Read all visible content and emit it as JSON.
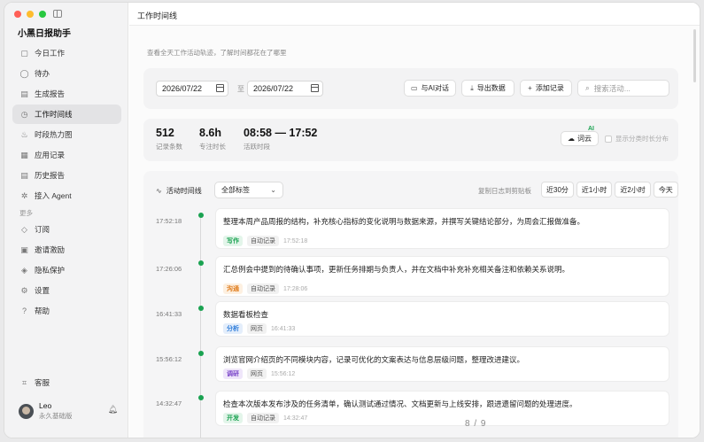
{
  "window": {
    "controls": [
      "#ff5f57",
      "#febc2e",
      "#28c840"
    ]
  },
  "sidebar": {
    "app_title": "小黑日报助手",
    "items": [
      {
        "label": "今日工作",
        "icon": "today-icon",
        "glyph": "▢"
      },
      {
        "label": "待办",
        "icon": "todo-icon",
        "glyph": "◯"
      },
      {
        "label": "生成报告",
        "icon": "report-icon",
        "glyph": "▤"
      },
      {
        "label": "工作时间线",
        "icon": "clock-icon",
        "glyph": "◷",
        "active": true
      },
      {
        "label": "时段热力图",
        "icon": "flame-icon",
        "glyph": "♨"
      },
      {
        "label": "应用记录",
        "icon": "apps-icon",
        "glyph": "▦"
      },
      {
        "label": "历史报告",
        "icon": "history-icon",
        "glyph": "▤"
      },
      {
        "label": "接入 Agent",
        "icon": "agent-icon",
        "glyph": "✲"
      }
    ],
    "more_label": "更多",
    "more_items": [
      {
        "label": "订阅",
        "icon": "subscribe-icon",
        "glyph": "◇"
      },
      {
        "label": "邀请激励",
        "icon": "gift-icon",
        "glyph": "▣"
      },
      {
        "label": "隐私保护",
        "icon": "shield-icon",
        "glyph": "◈"
      },
      {
        "label": "设置",
        "icon": "gear-icon",
        "glyph": "⚙"
      },
      {
        "label": "帮助",
        "icon": "help-icon",
        "glyph": "?"
      }
    ],
    "support_label": "客服",
    "user": {
      "name": "Leo",
      "plan": "永久基础版"
    }
  },
  "header": {
    "title": "工作时间线",
    "subtitle": "查看全天工作活动轨迹，了解时间都花在了哪里"
  },
  "toolbar": {
    "date_from": "2026/07/22",
    "date_to": "2026/07/22",
    "to_label": "至",
    "ai_chat": "与AI对话",
    "export": "导出数据",
    "add_record": "添加记录",
    "search_placeholder": "搜索活动..."
  },
  "stats": [
    {
      "value": "512",
      "label": "记录条数"
    },
    {
      "value": "8.6h",
      "label": "专注时长"
    },
    {
      "value": "08:58 — 17:52",
      "label": "活跃时段"
    }
  ],
  "wordcloud": {
    "label": "词云",
    "badge": "AI"
  },
  "category_toggle": "显示分类时长分布",
  "timeline": {
    "title": "活动时间线",
    "tag_filter": "全部标签",
    "copy_label": "复制日志到剪贴板",
    "ranges": [
      "近30分",
      "近1小时",
      "近2小时",
      "今天"
    ],
    "entries": [
      {
        "time": "17:52:18",
        "text": "整理本周产品周报的结构，补充核心指标的变化说明与数据来源，并撰写关键结论部分，为周会汇报做准备。",
        "category": "写作",
        "cat_color": "#1aa251",
        "cat_bg": "#e3f5ea",
        "source": "自动记录",
        "meta_time": "17:52:18"
      },
      {
        "time": "17:26:06",
        "text": "汇总例会中提到的待确认事项，更新任务排期与负责人，并在文档中补充补充相关备注和依赖关系说明。",
        "category": "沟通",
        "cat_color": "#e07b1a",
        "cat_bg": "#fdf0e1",
        "source": "自动记录",
        "meta_time": "17:28:06"
      },
      {
        "time": "16:41:33",
        "text": "数据看板检查",
        "category": "分析",
        "cat_color": "#2b7bd9",
        "cat_bg": "#e4eefb",
        "source": "网页",
        "meta_time": "16:41:33"
      },
      {
        "time": "15:56:12",
        "text": "浏览官网介绍页的不同模块内容，记录可优化的文案表达与信息层级问题，整理改进建议。",
        "category": "调研",
        "cat_color": "#7a45c9",
        "cat_bg": "#efe6fa",
        "source": "网页",
        "meta_time": "15:56:12"
      },
      {
        "time": "14:32:47",
        "text": "检查本次版本发布涉及的任务清单，确认测试通过情况、文档更新与上线安排，跟进遗留问题的处理进度。",
        "category": "开发",
        "cat_color": "#1aa251",
        "cat_bg": "#e3f5ea",
        "source": "自动记录",
        "meta_time": "14:32:47"
      }
    ]
  },
  "pagination": "8 / 9"
}
